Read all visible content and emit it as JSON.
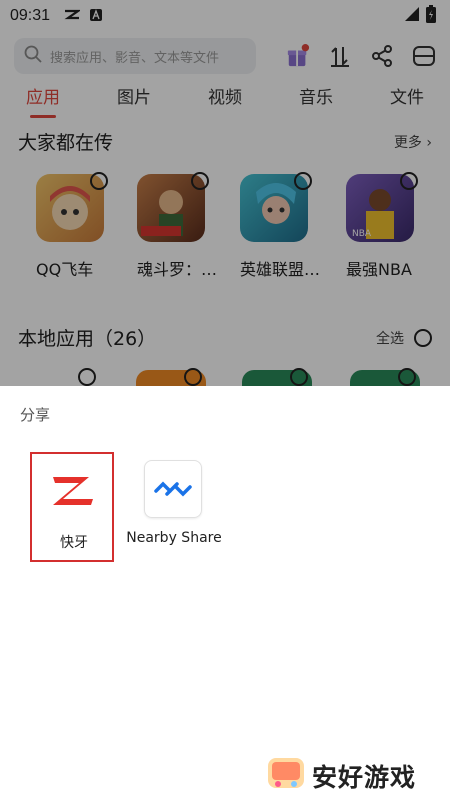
{
  "status_bar": {
    "time": "09:31"
  },
  "search": {
    "placeholder": "搜索应用、影音、文本等文件"
  },
  "tabs": [
    {
      "label": "应用",
      "active": true
    },
    {
      "label": "图片",
      "active": false
    },
    {
      "label": "视频",
      "active": false
    },
    {
      "label": "音乐",
      "active": false
    },
    {
      "label": "文件",
      "active": false
    }
  ],
  "popular": {
    "title": "大家都在传",
    "more": "更多",
    "apps": [
      {
        "name": "QQ飞车",
        "color": "#d9a24a"
      },
      {
        "name": "魂斗罗：…",
        "color": "#a35b3c"
      },
      {
        "name": "英雄联盟…",
        "color": "#2f9fb2"
      },
      {
        "name": "最强NBA",
        "color": "#6b4aa0"
      }
    ]
  },
  "local": {
    "title": "本地应用（26）",
    "select_all": "全选"
  },
  "share_sheet": {
    "title": "分享",
    "targets": [
      {
        "label": "快牙",
        "selected": true
      },
      {
        "label": "Nearby Share",
        "selected": false
      }
    ]
  },
  "watermark": {
    "text": "安好游戏"
  },
  "colors": {
    "accent": "#e0473d",
    "selection_border": "#d32f2f",
    "nearby_blue": "#1a73e8"
  }
}
